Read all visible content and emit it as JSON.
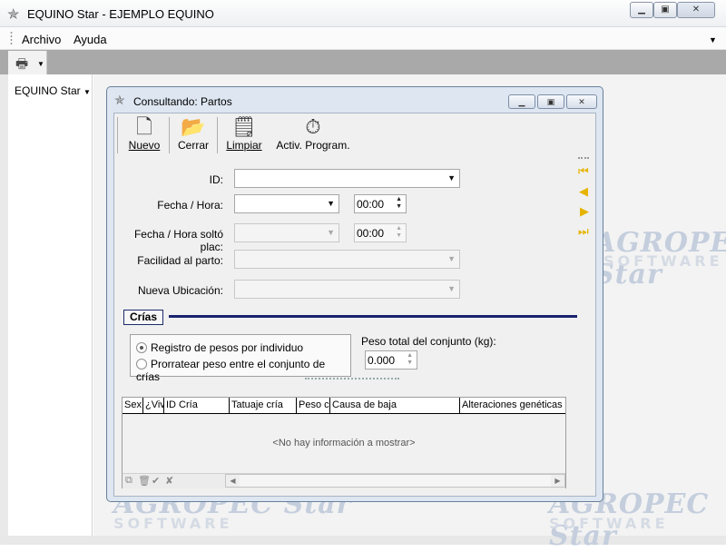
{
  "window": {
    "title": "EQUINO Star - EJEMPLO EQUINO",
    "app_icon": "star-icon",
    "controls": [
      "minimize",
      "maximize",
      "close"
    ]
  },
  "menu": {
    "items": [
      {
        "label": "Archivo",
        "mnemonic": "A"
      },
      {
        "label": "Ayuda",
        "mnemonic": "y"
      }
    ]
  },
  "toolbar": {
    "print_icon": "printer-icon"
  },
  "sidebar": {
    "title": "EQUINO Star"
  },
  "watermark": {
    "top": "AGROPEC Star",
    "bottom": "SOFTWARE"
  },
  "child": {
    "title": "Consultando: Partos",
    "toolbar": [
      {
        "label": "Nuevo",
        "icon": "new-document-icon"
      },
      {
        "label": "Cerrar",
        "icon": "open-folder-icon"
      },
      {
        "label": "Limpiar",
        "icon": "clean-document-icon"
      },
      {
        "label": "Activ. Program.",
        "icon": "stopwatch-icon"
      }
    ],
    "form": {
      "id_label": "ID:",
      "id_value": "",
      "fecha_label": "Fecha / Hora:",
      "fecha_value": "",
      "fecha_time": "00:00",
      "solto_label": "Fecha / Hora soltó plac:",
      "solto_value": "",
      "solto_time": "00:00",
      "facilidad_label": "Facilidad al parto:",
      "facilidad_value": "",
      "ubicacion_label": "Nueva Ubicación:",
      "ubicacion_value": ""
    },
    "record_nav": [
      "first-record-icon",
      "previous-record-icon",
      "next-record-icon",
      "last-record-icon"
    ],
    "crias": {
      "section_label": "Crías",
      "radio_options": [
        {
          "label": "Registro de pesos por individuo",
          "checked": true
        },
        {
          "label": "Prorratear peso entre el conjunto de crías",
          "checked": false
        }
      ],
      "peso_total_label": "Peso total del conjunto (kg):",
      "peso_total_value": "0.000",
      "grid": {
        "columns": [
          "Sex",
          "¿Viv",
          "ID Cría",
          "Tatuaje cría",
          "Peso cı",
          "Causa de baja",
          "Alteraciones genéticas"
        ],
        "rows": [],
        "empty_message": "<No hay información a mostrar>"
      }
    }
  }
}
